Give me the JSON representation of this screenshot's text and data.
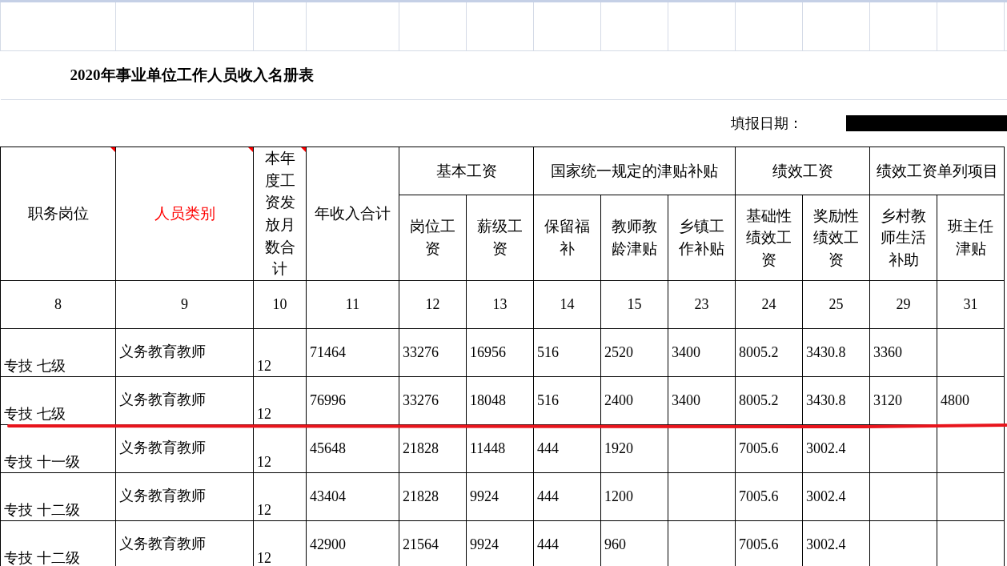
{
  "title": "2020年事业单位工作人员收入名册表",
  "date_label": "填报日期：",
  "header": [
    {
      "label": "职务岗位",
      "comment": true,
      "flagged": false
    },
    {
      "label": "人员类别",
      "comment": true,
      "flagged": true
    },
    {
      "label": "本年度工资发放月数合计",
      "comment": true,
      "flagged": false
    },
    {
      "label": "年收入合计",
      "comment": false,
      "flagged": false
    },
    {
      "label": "基本工资",
      "comment": false,
      "flagged": false,
      "children": [
        {
          "label": "岗位工资"
        },
        {
          "label": "薪级工资"
        }
      ]
    },
    {
      "label": "国家统一规定的津贴补贴",
      "comment": false,
      "flagged": false,
      "children": [
        {
          "label": "保留福补"
        },
        {
          "label": "教师教龄津贴"
        },
        {
          "label": "乡镇工作补贴"
        }
      ]
    },
    {
      "label": "绩效工资",
      "comment": false,
      "flagged": false,
      "children": [
        {
          "label": "基础性绩效工资"
        },
        {
          "label": "奖励性绩效工资"
        }
      ]
    },
    {
      "label": "绩效工资单列项目",
      "comment": false,
      "flagged": false,
      "children": [
        {
          "label": "乡村教师生活补助"
        },
        {
          "label": "班主任津贴"
        }
      ]
    }
  ],
  "column_numbers": [
    "8",
    "9",
    "10",
    "11",
    "12",
    "13",
    "14",
    "15",
    "23",
    "24",
    "25",
    "29",
    "31"
  ],
  "rows": [
    {
      "underlined": false,
      "cells": [
        "专技  七级",
        "义务教育教师",
        "12",
        "71464",
        "33276",
        "16956",
        "516",
        "2520",
        "3400",
        "8005.2",
        "3430.8",
        "3360",
        null
      ]
    },
    {
      "underlined": true,
      "cells": [
        "专技  七级",
        "义务教育教师",
        "12",
        "76996",
        "33276",
        "18048",
        "516",
        "2400",
        "3400",
        "8005.2",
        "3430.8",
        "3120",
        "4800"
      ]
    },
    {
      "underlined": false,
      "cells": [
        "专技  十一级",
        "义务教育教师",
        "12",
        "45648",
        "21828",
        "11448",
        "444",
        "1920",
        null,
        "7005.6",
        "3002.4",
        null,
        null
      ]
    },
    {
      "underlined": false,
      "cells": [
        "专技  十二级",
        "义务教育教师",
        "12",
        "43404",
        "21828",
        "9924",
        "444",
        "1200",
        null,
        "7005.6",
        "3002.4",
        null,
        null
      ]
    },
    {
      "underlined": false,
      "cells": [
        "专技  十二级",
        "义务教育教师",
        "12",
        "42900",
        "21564",
        "9924",
        "444",
        "960",
        null,
        "7005.6",
        "3002.4",
        null,
        null
      ]
    }
  ]
}
